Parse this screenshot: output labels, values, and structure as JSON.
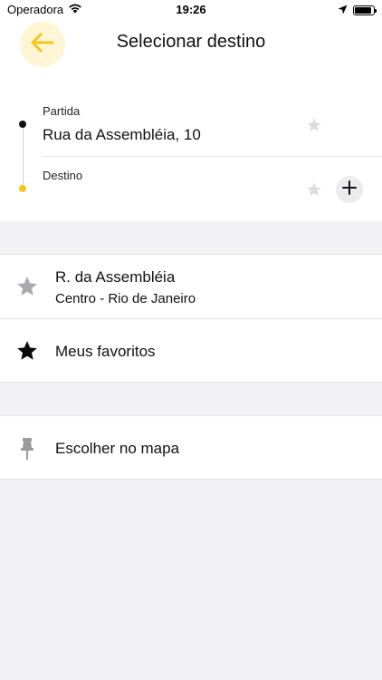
{
  "status_bar": {
    "carrier": "Operadora",
    "time": "19:26",
    "icons": [
      "wifi-icon",
      "location-arrow-icon",
      "battery-icon"
    ]
  },
  "header": {
    "title": "Selecionar destino",
    "back_icon": "arrow-left-icon",
    "accent_color": "#f5c518"
  },
  "route": {
    "origin": {
      "label": "Partida",
      "value": "Rua da Assembléia, 10"
    },
    "destination": {
      "label": "Destino",
      "value": ""
    }
  },
  "suggestions": [
    {
      "title": "R. da Assembléia",
      "subtitle": "Centro - Rio de Janeiro",
      "icon": "star-outline-icon"
    },
    {
      "title": "Meus favoritos",
      "icon": "star-filled-icon"
    }
  ],
  "map_option": {
    "title": "Escolher no mapa",
    "icon": "pin-icon"
  }
}
